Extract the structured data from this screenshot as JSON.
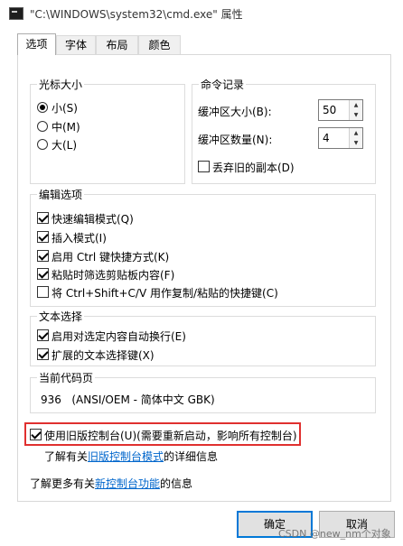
{
  "window": {
    "title": "\"C:\\WINDOWS\\system32\\cmd.exe\" 属性"
  },
  "tabs": [
    {
      "label": "选项",
      "active": true
    },
    {
      "label": "字体",
      "active": false
    },
    {
      "label": "布局",
      "active": false
    },
    {
      "label": "颜色",
      "active": false
    }
  ],
  "cursor_size": {
    "legend": "光标大小",
    "options": [
      {
        "label": "小(S)",
        "checked": true
      },
      {
        "label": "中(M)",
        "checked": false
      },
      {
        "label": "大(L)",
        "checked": false
      }
    ]
  },
  "command_history": {
    "legend": "命令记录",
    "buffer_size_label": "缓冲区大小(B):",
    "buffer_size_value": "50",
    "buffer_count_label": "缓冲区数量(N):",
    "buffer_count_value": "4",
    "discard_old_label": "丢弃旧的副本(D)",
    "discard_old_checked": false
  },
  "edit_options": {
    "legend": "编辑选项",
    "items": [
      {
        "label": "快速编辑模式(Q)",
        "checked": true
      },
      {
        "label": "插入模式(I)",
        "checked": true
      },
      {
        "label": "启用 Ctrl 键快捷方式(K)",
        "checked": true
      },
      {
        "label": "粘贴时筛选剪贴板内容(F)",
        "checked": true
      },
      {
        "label": "将 Ctrl+Shift+C/V 用作复制/粘贴的快捷键(C)",
        "checked": false
      }
    ]
  },
  "text_selection": {
    "legend": "文本选择",
    "items": [
      {
        "label": "启用对选定内容自动换行(E)",
        "checked": true
      },
      {
        "label": "扩展的文本选择键(X)",
        "checked": true
      }
    ]
  },
  "codepage": {
    "legend": "当前代码页",
    "value": "936   (ANSI/OEM - 简体中文 GBK)"
  },
  "legacy": {
    "label": "使用旧版控制台(U)(需要重新启动，影响所有控制台)",
    "checked": true,
    "learn_prefix": "了解有关",
    "learn_link": "旧版控制台模式",
    "learn_suffix": "的详细信息"
  },
  "new_console": {
    "prefix": "了解更多有关",
    "link": "新控制台功能",
    "suffix": "的信息"
  },
  "buttons": {
    "ok": "确定",
    "cancel": "取消"
  },
  "watermark": "CSDN @new_nm个对象",
  "colors": {
    "highlight": "#e0302f",
    "link": "#0066cc",
    "accent": "#0078d7"
  }
}
